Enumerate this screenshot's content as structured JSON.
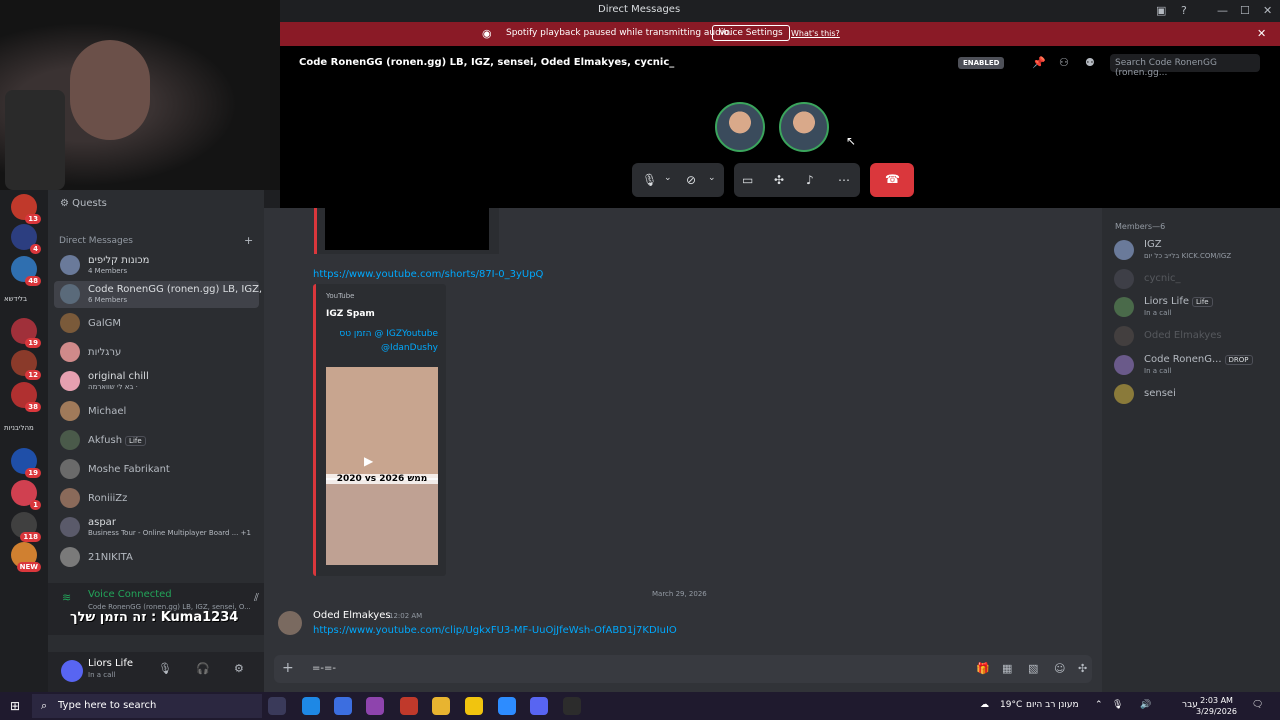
{
  "window": {
    "title": "Direct Messages"
  },
  "banner": {
    "message": "Spotify playback paused while transmitting audio.",
    "button": "Voice Settings",
    "link": "What's this?"
  },
  "call": {
    "title": "Code RonenGG (ronen.gg) LB, IGZ, sensei, Oded Elmakyes, cycnic_",
    "enabled_badge": "ENABLED",
    "search_placeholder": "Search Code RonenGG (ronen.gg..."
  },
  "servers": [
    {
      "badge": "13",
      "color": "#c0392b"
    },
    {
      "badge": "4",
      "color": "#2c3e80"
    },
    {
      "badge": "48",
      "color": "#2f6fb0"
    },
    {
      "label": "בלידשא"
    },
    {
      "badge": "19",
      "color": "#a0303a"
    },
    {
      "badge": "12",
      "color": "#8a3a2a"
    },
    {
      "badge": "38",
      "color": "#b03030"
    },
    {
      "label": "מהליבניות"
    },
    {
      "badge": "19",
      "color": "#1f4fa8"
    },
    {
      "badge": "1",
      "color": "#d04050"
    },
    {
      "badge": "118",
      "color": "#404040"
    },
    {
      "badge": "NEW",
      "color": "#d08030"
    }
  ],
  "sidebar": {
    "quests": "Quests",
    "dm_header": "Direct Messages",
    "dms": [
      {
        "name": "מכונות קליפים",
        "sub": "4 Members",
        "color": "#6a7a9a"
      },
      {
        "name": "Code RonenGG (ronen.gg) LB, IGZ, ...",
        "sub": "6 Members",
        "color": "#5a6a7a",
        "active": true
      },
      {
        "name": "GalGM",
        "sub": "",
        "color": "#7a5a3a"
      },
      {
        "name": "ערגליות",
        "sub": "",
        "color": "#d08a8a"
      },
      {
        "name": "original chill",
        "sub": "בא לי שווארמה ·",
        "color": "#e6a0b0"
      },
      {
        "name": "Michael",
        "sub": "",
        "color": "#a07a5a"
      },
      {
        "name": "Akfush",
        "sub": "",
        "color": "#4a5a4a",
        "badge": "Life"
      },
      {
        "name": "Moshe Fabrikant",
        "sub": "",
        "color": "#6a6a6a"
      },
      {
        "name": "RoniiiZz",
        "sub": "",
        "color": "#8a6a5a"
      },
      {
        "name": "aspar",
        "sub": "Business Tour - Online Multiplayer Board ... +1",
        "color": "#5a5a6a"
      },
      {
        "name": "21NIKITA",
        "sub": "",
        "color": "#7a7a7a"
      }
    ]
  },
  "voice": {
    "status": "Voice Connected",
    "channel": "Code RonenGG (ronen.gg) LB, IGZ, sensei, O...",
    "overlay_text": "זה הזמן שלך : Kuma1234"
  },
  "user": {
    "name": "Liors Life",
    "status": "In a call"
  },
  "chat": {
    "link1": "https://www.youtube.com/shorts/87I-0_3yUpQ",
    "embed": {
      "provider": "YouTube",
      "title": "IGZ Spam",
      "description": "הזמן טס @ IGZYoutube @IdanDushy",
      "thumb_text": "2020 vs 2026 ממש"
    },
    "date_separator": "March 29, 2026",
    "message": {
      "author": "Oded Elmakyes",
      "time": "12:02 AM",
      "text": "https://www.youtube.com/clip/UgkxFU3-MF-UuOjJfeWsh-OfABD1j7KDIuIO"
    },
    "input_value": "=-=-"
  },
  "members": {
    "header": "Members—6",
    "list": [
      {
        "name": "IGZ",
        "sub": "בלייב כל יום KICK.COM/IGZ",
        "color": "#6a7a9a"
      },
      {
        "name": "cycnic_",
        "sub": "",
        "color": "#6a6a7a",
        "offline": true
      },
      {
        "name": "Liors Life",
        "sub": "In a call",
        "color": "#4a6a4a",
        "badge": "Life"
      },
      {
        "name": "Oded Elmakyes",
        "sub": "",
        "color": "#7a6a60",
        "offline": true
      },
      {
        "name": "Code RonenG...",
        "sub": "In a call",
        "color": "#6a5a8a",
        "badge": "DROP"
      },
      {
        "name": "sensei",
        "sub": "",
        "color": "#8a7a3a"
      }
    ]
  },
  "taskbar": {
    "search_placeholder": "Type here to search",
    "weather": "19°C",
    "weather_text": "מעונן רב היום",
    "lang": "עבר",
    "time": "2:03 AM",
    "date": "3/29/2026"
  }
}
